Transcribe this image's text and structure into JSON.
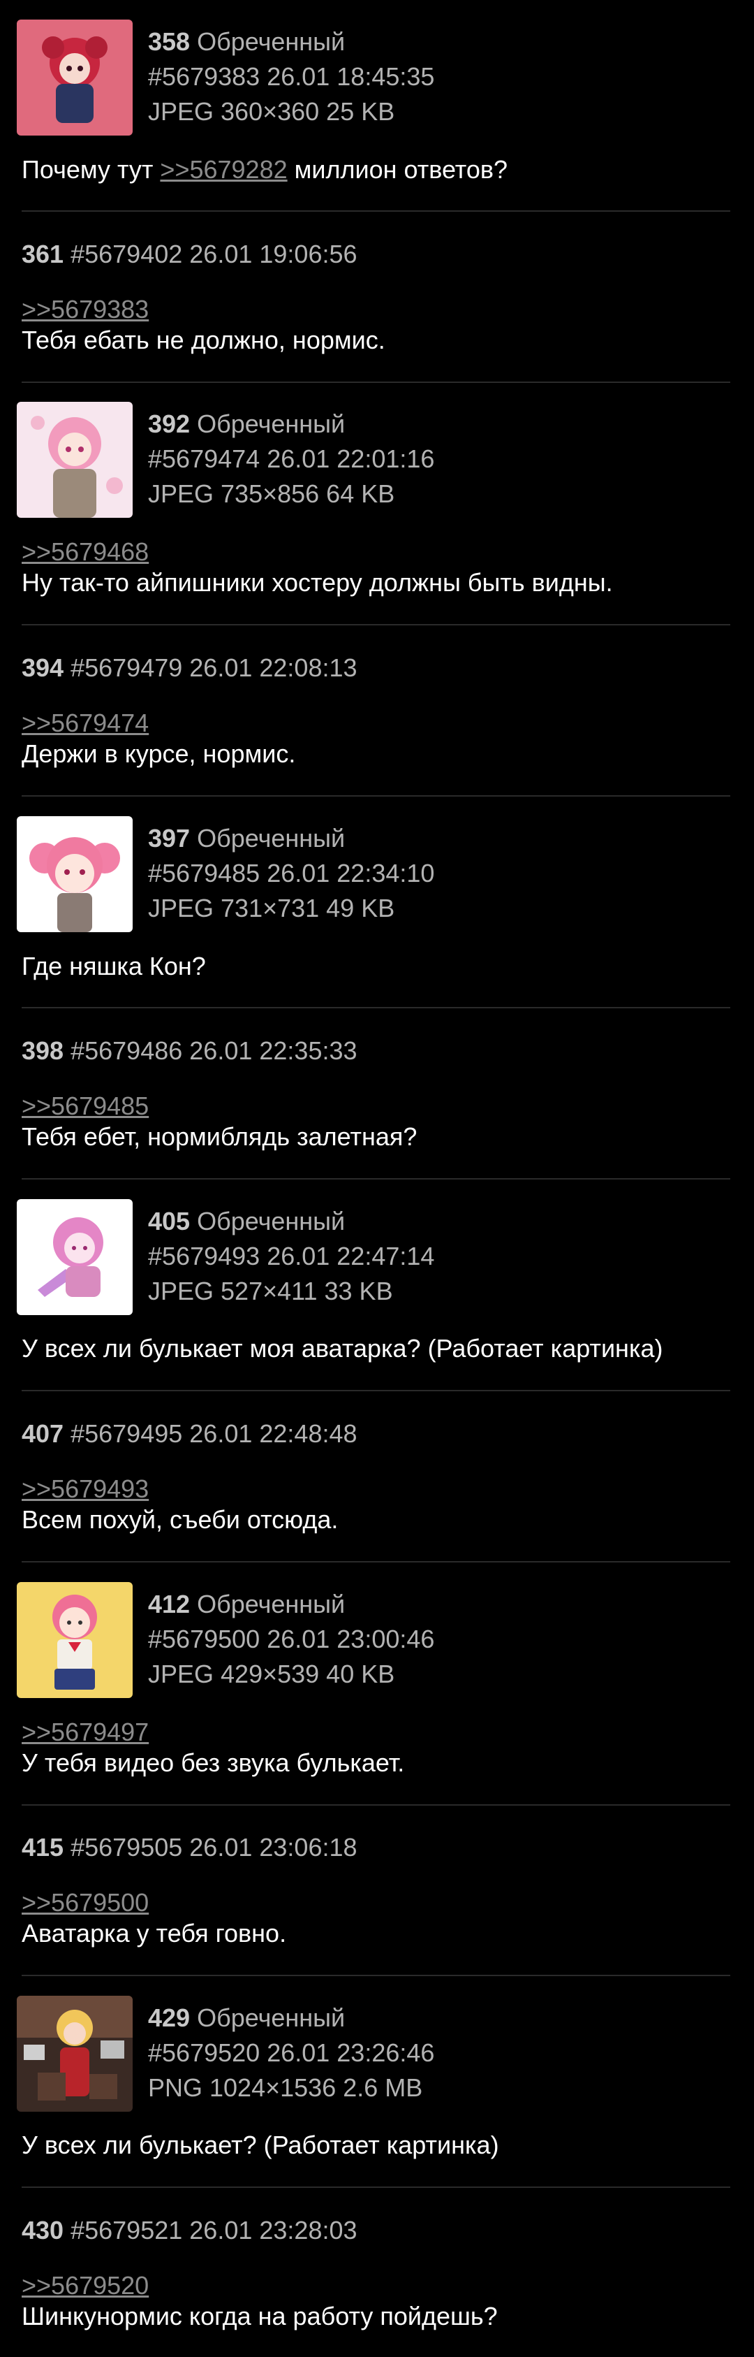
{
  "thread": {
    "posts": [
      {
        "num": "358",
        "name": "Обреченный",
        "id": "#5679383",
        "datetime": "26.01 18:45:35",
        "file": "JPEG 360×360 25 KB",
        "reply_to": "",
        "text_pre": "Почему тут ",
        "text_link": ">>5679282",
        "text_post": " миллион ответов?"
      },
      {
        "num": "361",
        "id": "#5679402",
        "datetime": "26.01 19:06:56",
        "reply_to": ">>5679383",
        "text": "Тебя ебать не должно, нормис."
      },
      {
        "num": "392",
        "name": "Обреченный",
        "id": "#5679474",
        "datetime": "26.01 22:01:16",
        "file": "JPEG 735×856 64 KB",
        "reply_to": ">>5679468",
        "text": "Ну так-то айпишники хостеру должны быть видны."
      },
      {
        "num": "394",
        "id": "#5679479",
        "datetime": "26.01 22:08:13",
        "reply_to": ">>5679474",
        "text": "Держи в курсе, нормис."
      },
      {
        "num": "397",
        "name": "Обреченный",
        "id": "#5679485",
        "datetime": "26.01 22:34:10",
        "file": "JPEG 731×731 49 KB",
        "text": "Где няшка Кон?"
      },
      {
        "num": "398",
        "id": "#5679486",
        "datetime": "26.01 22:35:33",
        "reply_to": ">>5679485",
        "text": "Тебя ебет, нормиблядь залетная?"
      },
      {
        "num": "405",
        "name": "Обреченный",
        "id": "#5679493",
        "datetime": "26.01 22:47:14",
        "file": "JPEG 527×411 33 KB",
        "text": "У всех ли булькает моя аватарка? (Работает картинка)"
      },
      {
        "num": "407",
        "id": "#5679495",
        "datetime": "26.01 22:48:48",
        "reply_to": ">>5679493",
        "text": "Всем похуй, съеби отсюда."
      },
      {
        "num": "412",
        "name": "Обреченный",
        "id": "#5679500",
        "datetime": "26.01 23:00:46",
        "file": "JPEG 429×539 40 KB",
        "reply_to": ">>5679497",
        "text": "У тебя видео без звука булькает."
      },
      {
        "num": "415",
        "id": "#5679505",
        "datetime": "26.01 23:06:18",
        "reply_to": ">>5679500",
        "text": "Аватарка у тебя говно."
      },
      {
        "num": "429",
        "name": "Обреченный",
        "id": "#5679520",
        "datetime": "26.01 23:26:46",
        "file": "PNG 1024×1536 2.6 MB",
        "text": "У всех ли булькает? (Работает картинка)"
      },
      {
        "num": "430",
        "id": "#5679521",
        "datetime": "26.01 23:28:03",
        "reply_to": ">>5679520",
        "text": "Шинкунормис когда на работу пойдешь?"
      }
    ]
  },
  "colors": {
    "background": "#000000",
    "text": "#ffffff",
    "meta": "#b3b3b3",
    "link": "#8c8c8c",
    "divider": "#2a2a2a"
  }
}
